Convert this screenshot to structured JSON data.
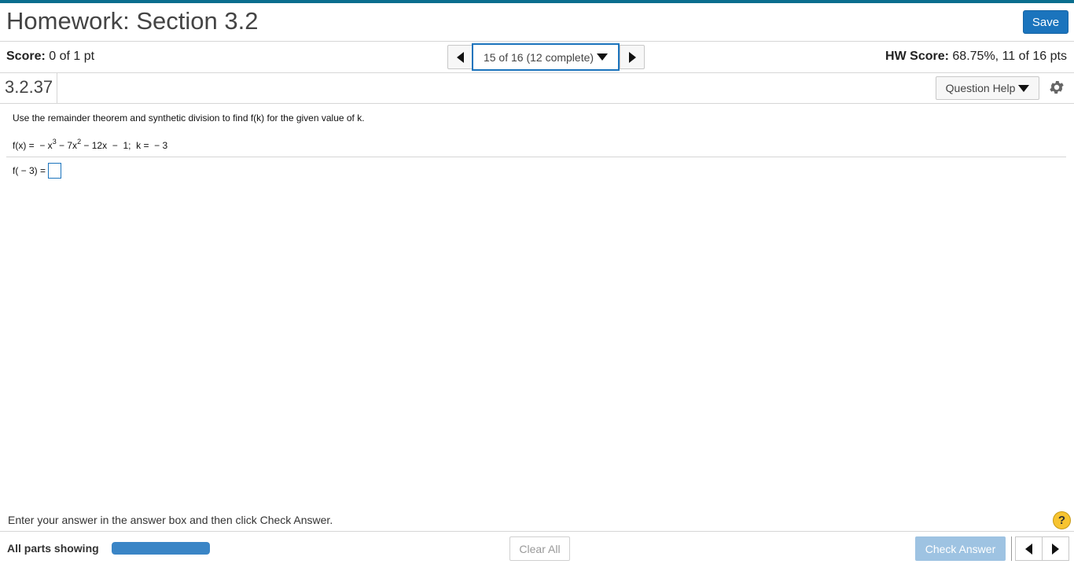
{
  "header": {
    "title": "Homework: Section 3.2",
    "save_label": "Save"
  },
  "score": {
    "label": "Score:",
    "value": "0 of 1 pt"
  },
  "question_nav": {
    "selected": "15 of 16 (12 complete)"
  },
  "hw_score": {
    "label": "HW Score:",
    "value": "68.75%, 11 of 16 pts"
  },
  "question": {
    "number": "3.2.37",
    "help_label": "Question Help",
    "instructions": "Use the remainder theorem and synthetic division to find f(k) for the given value of k.",
    "formula": {
      "p1": "f(x) =  − x",
      "e1": "3",
      "p2": " − 7x",
      "e2": "2",
      "p3": " − 12x  −  1;  k =  − 3"
    },
    "answer_prompt": "f( − 3) ="
  },
  "footer": {
    "message": "Enter your answer in the answer box and then click Check Answer.",
    "help_symbol": "?",
    "parts_label": "All parts showing",
    "parts_progress": 1.0,
    "clear_all_label": "Clear All",
    "check_answer_label": "Check Answer"
  },
  "colors": {
    "accent": "#1b74bd",
    "topbar": "#0a6e8e",
    "progress": "#3a85c6",
    "check_disabled": "#9ec3e2",
    "help_yellow": "#f7c431"
  },
  "icons": [
    "chevron-left-icon",
    "chevron-right-icon",
    "caret-down-icon",
    "gear-icon",
    "question-circle-icon"
  ]
}
